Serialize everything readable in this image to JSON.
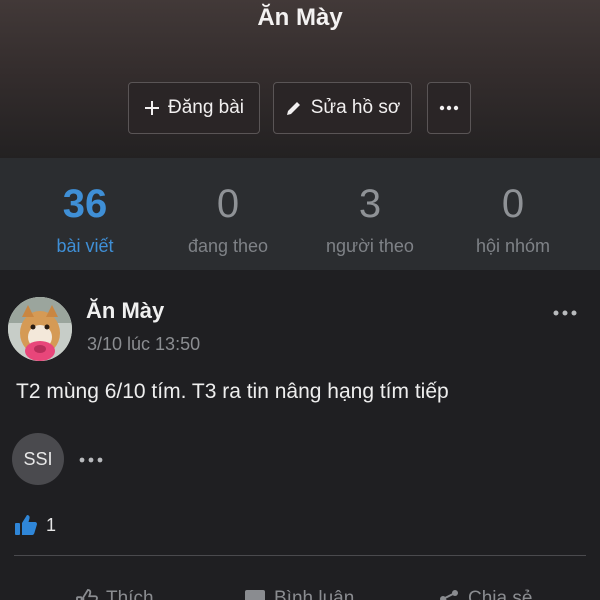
{
  "profile": {
    "name": "Ăn Mày",
    "buttons": {
      "post_label": "Đăng bài",
      "edit_label": "Sửa hồ sơ"
    }
  },
  "stats": [
    {
      "value": "36",
      "label": "bài viết"
    },
    {
      "value": "0",
      "label": "đang theo"
    },
    {
      "value": "3",
      "label": "người theo"
    },
    {
      "value": "0",
      "label": "hội nhóm"
    }
  ],
  "post": {
    "author": "Ăn Mày",
    "time": "3/10 lúc 13:50",
    "text": "T2 mùng 6/10 tím. T3 ra tin nâng hạng tím tiếp",
    "tag": "SSI",
    "like_count": "1",
    "actions": {
      "like": "Thích",
      "comment": "Bình luận",
      "share": "Chia sẻ"
    }
  },
  "colors": {
    "accent": "#3f8fd6",
    "background": "#1f1f22",
    "stats_background": "#2b2d30"
  }
}
